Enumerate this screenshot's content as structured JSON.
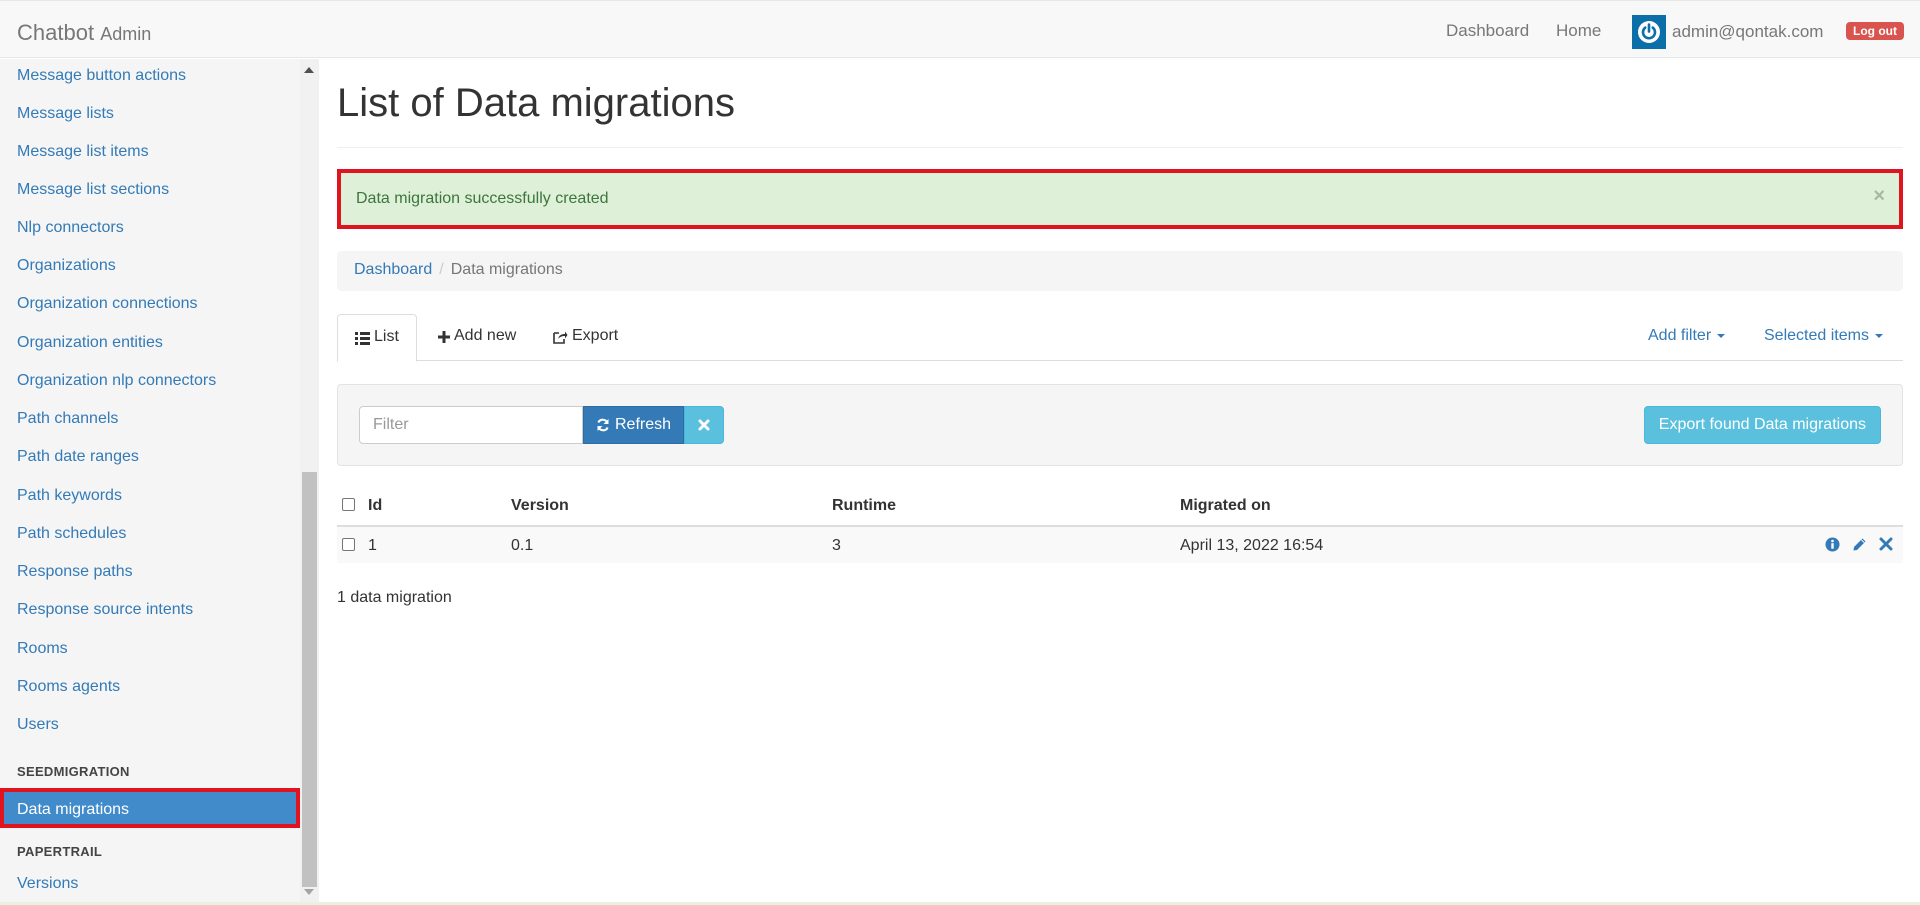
{
  "navbar": {
    "brand": "Chatbot",
    "brand_sub": "Admin",
    "links": [
      "Dashboard",
      "Home"
    ],
    "user_email": "admin@qontak.com",
    "logout_label": "Log out"
  },
  "sidebar": {
    "items": [
      "Message button actions",
      "Message lists",
      "Message list items",
      "Message list sections",
      "Nlp connectors",
      "Organizations",
      "Organization connections",
      "Organization entities",
      "Organization nlp connectors",
      "Path channels",
      "Path date ranges",
      "Path keywords",
      "Path schedules",
      "Response paths",
      "Response source intents",
      "Rooms",
      "Rooms agents",
      "Users"
    ],
    "section_seed": "SEEDMIGRATION",
    "active_item": "Data migrations",
    "section_paper": "PAPERTRAIL",
    "last_item": "Versions"
  },
  "main": {
    "title": "List of Data migrations",
    "alert": "Data migration successfully created",
    "alert_close": "×",
    "breadcrumb": {
      "home": "Dashboard",
      "sep": "/",
      "current": "Data migrations"
    },
    "tabs": {
      "list": "List",
      "add_new": "Add new",
      "export": "Export",
      "add_filter": "Add filter",
      "selected_items": "Selected items"
    },
    "filter": {
      "placeholder": "Filter",
      "refresh_label": "Refresh",
      "export_label": "Export found Data migrations"
    },
    "table": {
      "headers": [
        "Id",
        "Version",
        "Runtime",
        "Migrated on"
      ],
      "rows": [
        {
          "id": "1",
          "version": "0.1",
          "runtime": "3",
          "migrated_on": "April 13, 2022 16:54"
        }
      ]
    },
    "count_text": "1 data migration"
  },
  "colors": {
    "link": "#337ab7",
    "active_bg": "#428bca",
    "highlight_border": "#e0141e",
    "alert_bg": "#dff0d8",
    "info_btn": "#5bc0de",
    "danger": "#d9534f"
  }
}
